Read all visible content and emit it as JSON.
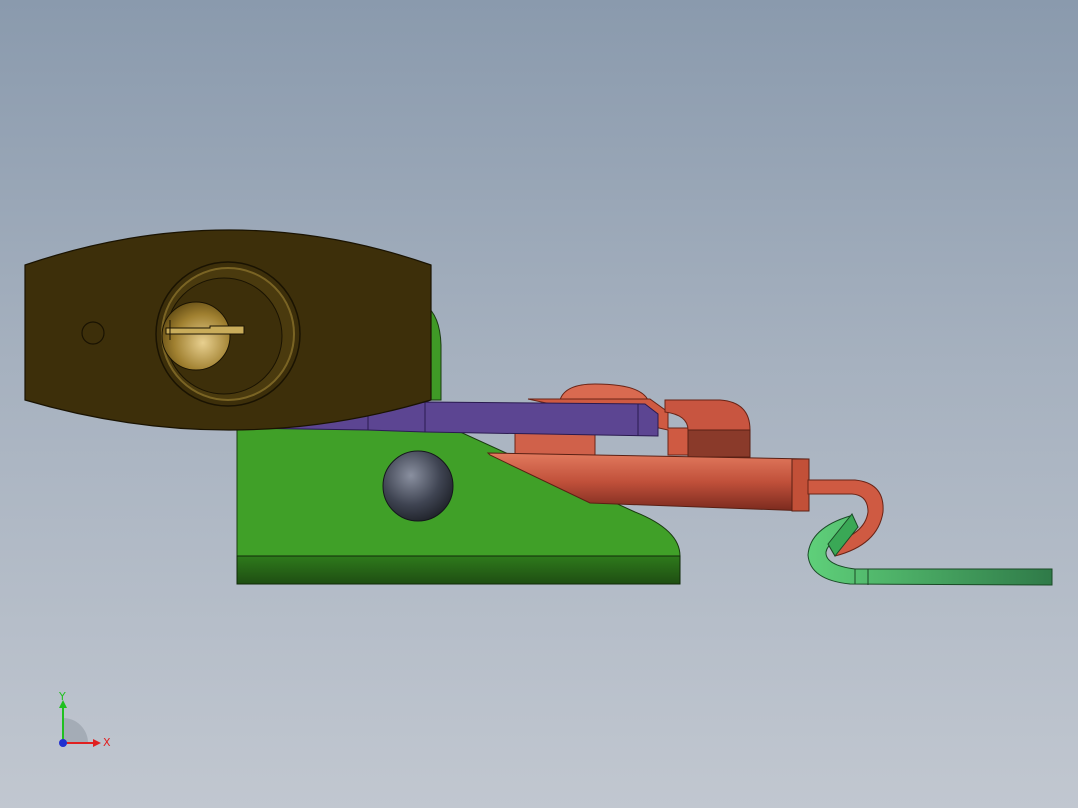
{
  "triad": {
    "x_label": "X",
    "y_label": "Y",
    "x_color": "#e02020",
    "y_color": "#20c020",
    "z_color": "#2030d0"
  },
  "parts": [
    {
      "name": "padlock-body",
      "color": "#3d2f0a"
    },
    {
      "name": "lock-cylinder",
      "color": "#b89a48"
    },
    {
      "name": "hasp-plate",
      "color": "#5c4592"
    },
    {
      "name": "base-bracket",
      "color": "#40a028"
    },
    {
      "name": "knob",
      "color": "#3a3f4a"
    },
    {
      "name": "latch-bolt",
      "color": "#d05840"
    },
    {
      "name": "spring-clip",
      "color": "#4aa860"
    }
  ]
}
